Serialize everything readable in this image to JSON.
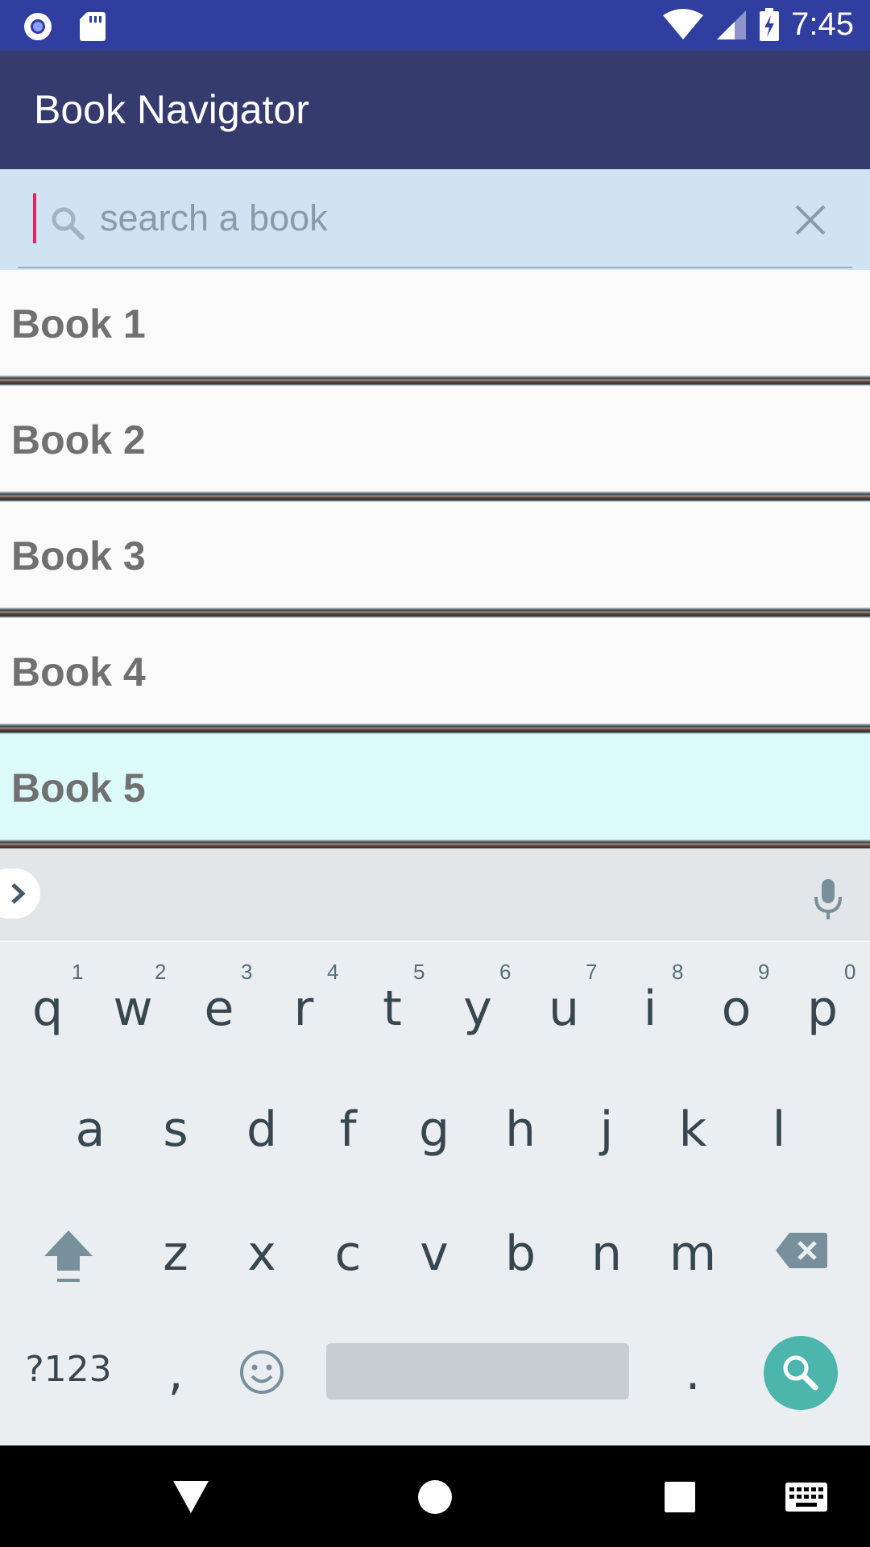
{
  "status_bar": {
    "time": "7:45",
    "icons": [
      "record-icon",
      "sd-card-icon",
      "wifi-icon",
      "signal-icon",
      "battery-charging-icon"
    ]
  },
  "app_bar": {
    "title": "Book Navigator"
  },
  "search": {
    "placeholder": "search a book",
    "value": ""
  },
  "books": [
    {
      "label": "Book 1"
    },
    {
      "label": "Book 2"
    },
    {
      "label": "Book 3"
    },
    {
      "label": "Book 4"
    },
    {
      "label": "Book 5",
      "selected": true
    }
  ],
  "keyboard": {
    "row1": [
      [
        "q",
        "1"
      ],
      [
        "w",
        "2"
      ],
      [
        "e",
        "3"
      ],
      [
        "r",
        "4"
      ],
      [
        "t",
        "5"
      ],
      [
        "y",
        "6"
      ],
      [
        "u",
        "7"
      ],
      [
        "i",
        "8"
      ],
      [
        "o",
        "9"
      ],
      [
        "p",
        "0"
      ]
    ],
    "row2": [
      "a",
      "s",
      "d",
      "f",
      "g",
      "h",
      "j",
      "k",
      "l"
    ],
    "row3": [
      "z",
      "x",
      "c",
      "v",
      "b",
      "n",
      "m"
    ],
    "symbols_label": "?123",
    "comma": ",",
    "period": "."
  },
  "colors": {
    "status_bar": "#303f9f",
    "app_bar": "#353b6d",
    "search_bg": "#cfe3f2",
    "cursor": "#e91e63",
    "selected_row": "#dcfafa",
    "action_key": "#4db6ac"
  }
}
